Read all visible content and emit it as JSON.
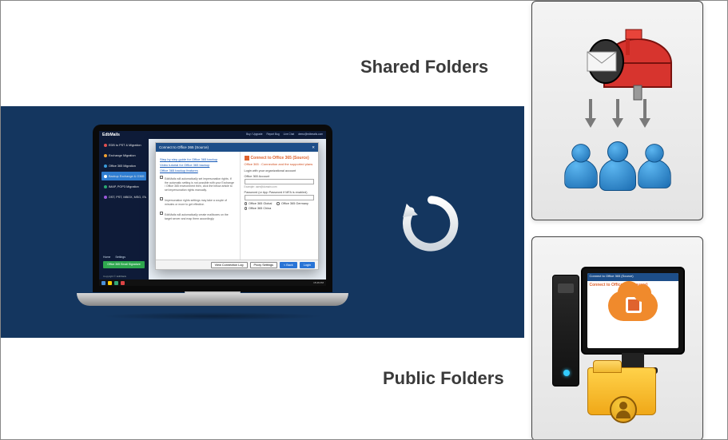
{
  "labels": {
    "shared": "Shared Folders",
    "public": "Public Folders"
  },
  "laptop": {
    "app_name": "EdbMails",
    "top_links": [
      "Buy / Upgrade",
      "Report Bug",
      "Live Chat",
      "demo@edbmails.com"
    ],
    "sidebar": [
      {
        "label": "EDB to PST & Migration",
        "color": "#e05050"
      },
      {
        "label": "Exchange Migration",
        "color": "#f0a030"
      },
      {
        "label": "Office 365 Migration",
        "color": "#3a9ada"
      },
      {
        "label": "Backup Exchange & O365",
        "color": "#2f7dd1",
        "selected": true
      },
      {
        "label": "IMAP, POP3 Migration",
        "color": "#28a870"
      },
      {
        "label": "OST, PST, MBOX, MSG, EML",
        "color": "#9a58da"
      }
    ],
    "bottom_tabs": [
      "Home",
      "Settings"
    ],
    "green_button": "Office 365 Email Signature",
    "copyright": "Copyright © EdbMails",
    "dialog": {
      "title": "Connect to Office 365 (Source)",
      "left_links": [
        "Step by step guide for Office 365 backup",
        "Video tutorial for Office 365 backup",
        "Office 365 backup features"
      ],
      "left_checks": [
        "EdbMails will automatically set impersonation rights. If the automatic setting is not possible with your Exchange / Office 365 environment then, click the below article to set impersonation rights manually.",
        "Impersonation rights settings may take a couple of minutes or more to get effective.",
        "EdbMails will automatically create mailboxes on the target server and map them accordingly."
      ],
      "right_brand": "Connect to Office 365 (Source)",
      "right_sub": "Office 365 : Connection and the supported plans",
      "login_heading": "Login with your organizational account",
      "acct_label": "Office 365 Account",
      "acct_example": "Example: user@domain.com",
      "pwd_label": "Password (or App Password if MFA is enabled)",
      "radios": [
        "Office 365 Global",
        "Office 365 Germany",
        "Office 365 China"
      ],
      "footer": [
        "View Connection Log",
        "Proxy Settings",
        "< Back",
        "Login"
      ]
    },
    "taskbar_time": "15:46 PM"
  }
}
